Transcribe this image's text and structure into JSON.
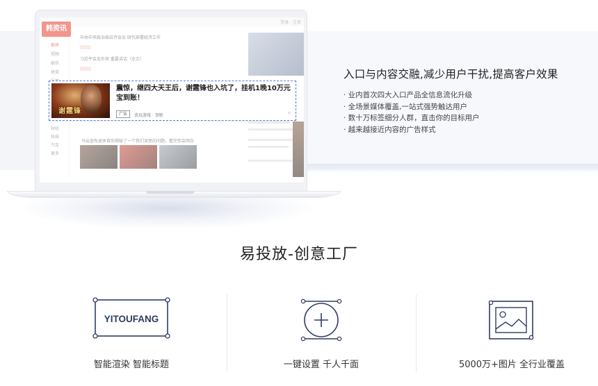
{
  "mockup": {
    "logo": "韩资讯",
    "topbar_text": "登录 · 注册",
    "left_nav": [
      "推荐",
      "视频",
      "娱乐",
      "体育",
      "军事"
    ],
    "left_nav_lower": [
      "财经",
      "科技",
      "汽车",
      "更多"
    ],
    "news_1": "中共中央政治局召开会议 研究部署经济工作",
    "news_2": "习近平会见外宾 重要讲话（全文）",
    "news_bottom": "马云宣布退休背后揭秘了一个我们深思的问题，看完你会明白",
    "ad": {
      "title": "震惊，继四大天王后，谢霆锋也入坑了，挂机1晚10万元宝到账！",
      "tag": "广告",
      "source": "贪玩游戏 · 顶新",
      "close": "×",
      "thumb_label": "谢霆锋"
    }
  },
  "feature_block": {
    "title": "入口与内容交融,减少用户干扰,提高客户效果",
    "items": [
      "· 业内首次四大入口产品全信息流化升级",
      "· 全场景媒体覆盖,一站式强势触达用户",
      "· 数十万标签细分人群，直击你的目标用户",
      "· 越来越接近内容的广告样式"
    ]
  },
  "section_title": "易投放-创意工厂",
  "features": [
    {
      "icon": "yitoufang-logo-icon",
      "logo_text": "YITOUFANG",
      "caption": "智能渲染 智能标题"
    },
    {
      "icon": "plus-circle-icon",
      "caption": "一键设置 千人千面"
    },
    {
      "icon": "image-frame-icon",
      "caption": "5000万+图片 全行业覆盖"
    }
  ],
  "colors": {
    "accent_blue": "#2f3b63",
    "ad_outline": "#5a78d8",
    "logo_red": "#e8402d"
  }
}
